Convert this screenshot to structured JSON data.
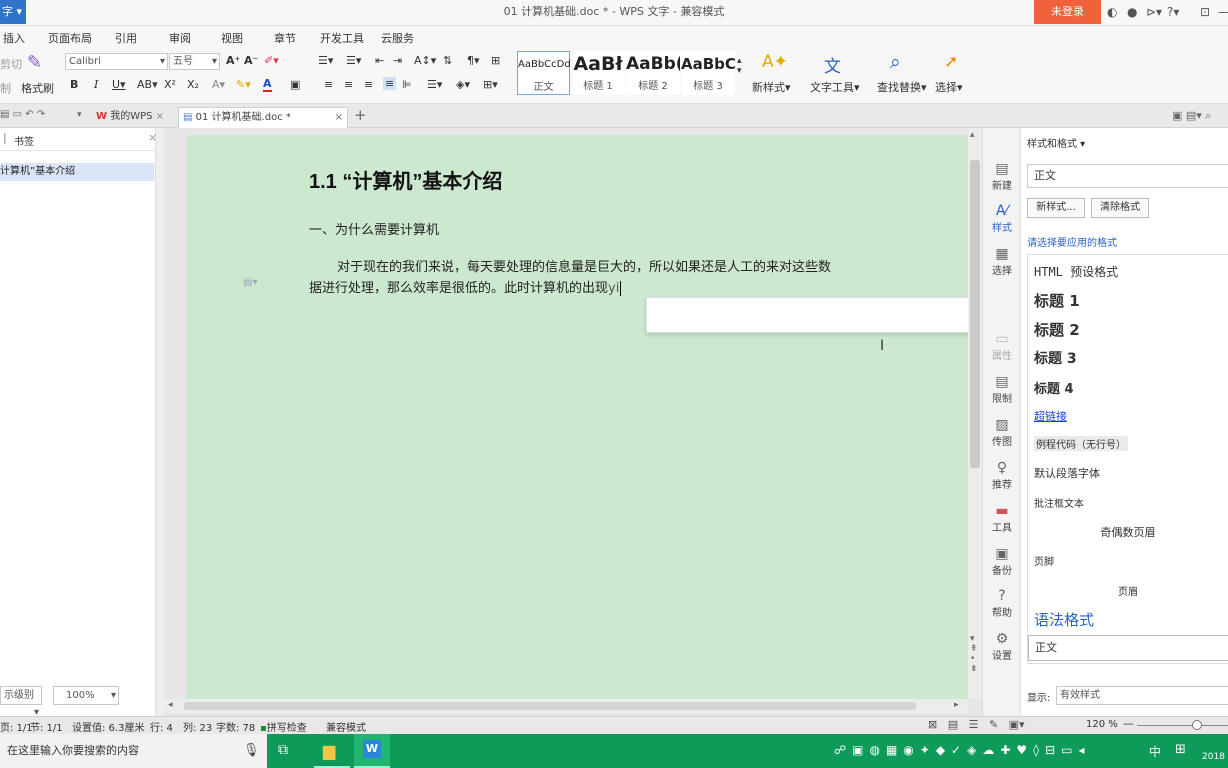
{
  "titlebar": {
    "app_btn": "字",
    "title": "01 计算机基础.doc * - WPS 文字 - 兼容模式",
    "login": "未登录"
  },
  "menu": [
    "插入",
    "页面布局",
    "引用",
    "审阅",
    "视图",
    "章节",
    "开发工具",
    "云服务"
  ],
  "ribbon": {
    "font_name": "Calibri",
    "font_size": "五号",
    "format_painter": "格式刷",
    "copy_partial": "制",
    "cut_partial": "剪切",
    "styles": [
      {
        "preview": "AaBbCcDd",
        "name": "正文"
      },
      {
        "preview": "AaBł",
        "name": "标题 1"
      },
      {
        "preview": "AaBb(",
        "name": "标题 2"
      },
      {
        "preview": "AaBbC",
        "name": "标题 3"
      }
    ],
    "new_style": "新样式",
    "text_tools": "文字工具",
    "find_replace": "查找替换",
    "select": "选择"
  },
  "tabs": {
    "wps": "我的WPS",
    "doc": "01 计算机基础.doc *"
  },
  "leftpane": {
    "tab": "书签",
    "item": "计算机”基本介绍",
    "level": "示级别",
    "zoom": "100%"
  },
  "document": {
    "heading": "1.1 “计算机”基本介绍",
    "subheading": "一、为什么需要计算机",
    "para_line1": "对于现在的我们来说，每天要处理的信息量是巨大的，所以如果还是人工的来对这些数",
    "para_line2": "据进行处理，那么效率是很低的。此时计算机的出现",
    "typing": "yi"
  },
  "sideicons": [
    "新建",
    "样式",
    "选择",
    "属性",
    "限制",
    "传图",
    "推荐",
    "工具",
    "备份",
    "帮助",
    "设置"
  ],
  "stylepanel": {
    "title": "样式和格式",
    "current": "正文",
    "new_btn": "新样式...",
    "clear_btn": "清除格式",
    "hint": "请选择要应用的格式",
    "items": [
      "HTML 预设格式",
      "标题 1",
      "标题 2",
      "标题 3",
      "标题 4",
      "超链接",
      "例程代码（无行号）",
      "默认段落字体",
      "批注框文本",
      "奇偶数页眉",
      "页脚",
      "页眉",
      "语法格式",
      "正文"
    ],
    "show_label": "显示:",
    "show_value": "有效样式"
  },
  "statusbar": {
    "page": "页: 1/1",
    "section": "节: 1/1",
    "setting": "设置值: 6.3厘米",
    "row": "行: 4",
    "col": "列: 23",
    "words": "字数: 78",
    "spell": "拼写检查",
    "compat": "兼容模式",
    "zoom": "120 %"
  },
  "taskbar": {
    "search": "在这里输入你要搜索的内容",
    "date": "2018"
  }
}
